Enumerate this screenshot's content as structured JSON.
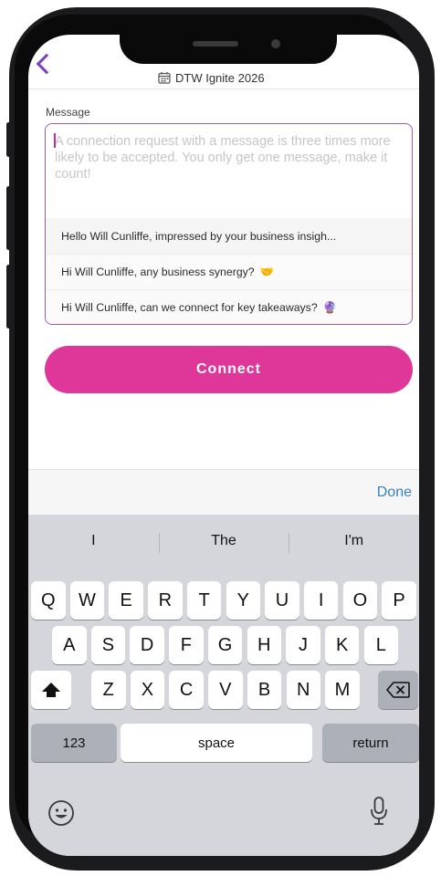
{
  "header": {
    "event_title": "DTW Ignite 2026"
  },
  "message": {
    "label": "Message",
    "placeholder": "A connection request with a message is three times more likely to be accepted. You only get one message, make it count!",
    "suggestions": [
      {
        "text": "Hello Will Cunliffe, impressed by your business insigh...",
        "emoji": ""
      },
      {
        "text": "Hi Will Cunliffe, any business synergy?",
        "emoji": "🤝"
      },
      {
        "text": "Hi Will Cunliffe, can we connect for key takeaways?",
        "emoji": "🔮"
      }
    ]
  },
  "connect_button": {
    "label": "Connect"
  },
  "keyboard": {
    "done_label": "Done",
    "predictions": [
      "I",
      "The",
      "I'm"
    ],
    "row1": [
      "Q",
      "W",
      "E",
      "R",
      "T",
      "Y",
      "U",
      "I",
      "O",
      "P"
    ],
    "row2": [
      "A",
      "S",
      "D",
      "F",
      "G",
      "H",
      "J",
      "K",
      "L"
    ],
    "row3": [
      "Z",
      "X",
      "C",
      "V",
      "B",
      "N",
      "M"
    ],
    "numbers_label": "123",
    "space_label": "space",
    "return_label": "return"
  },
  "colors": {
    "accent_purple": "#9b59c8",
    "connect_pink": "#df3699",
    "done_blue": "#3b82c4"
  },
  "icons": {
    "back": "chevron-left-icon",
    "event": "calendar-icon",
    "shift": "shift-icon",
    "backspace": "backspace-icon",
    "emoji": "emoji-icon",
    "mic": "microphone-icon"
  }
}
